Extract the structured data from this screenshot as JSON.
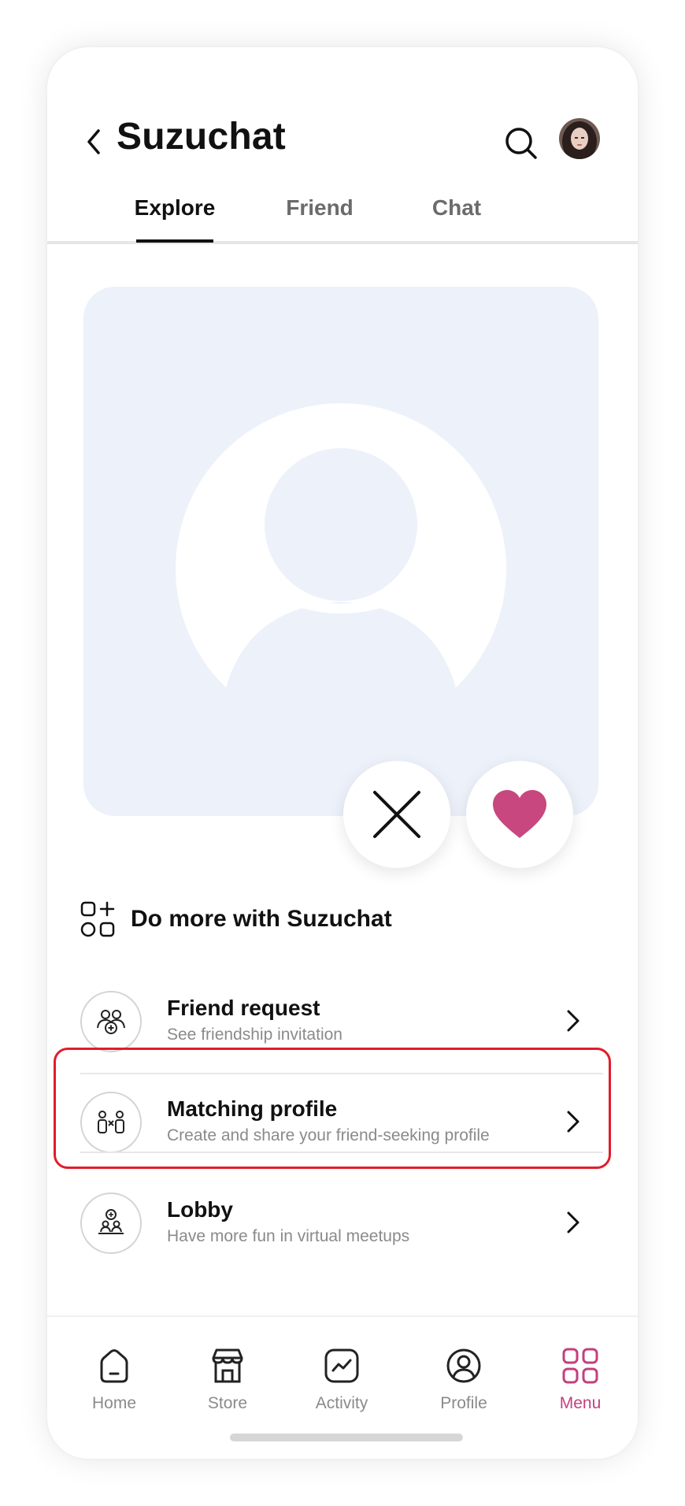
{
  "header": {
    "title": "Suzuchat"
  },
  "tabs": [
    {
      "label": "Explore",
      "active": true
    },
    {
      "label": "Friend",
      "active": false
    },
    {
      "label": "Chat",
      "active": false
    }
  ],
  "actions": {
    "dislike_icon": "close-x-icon",
    "like_icon": "heart-icon",
    "like_color": "#c8477f"
  },
  "do_more": {
    "label": "Do more with Suzuchat",
    "icon": "apps-plus-icon"
  },
  "list": [
    {
      "title": "Friend request",
      "subtitle": "See friendship invitation",
      "icon": "friend-request-icon"
    },
    {
      "title": "Matching profile",
      "subtitle": "Create and share your friend-seeking profile",
      "icon": "matching-profile-icon",
      "highlighted": true
    },
    {
      "title": "Lobby",
      "subtitle": "Have more fun in virtual meetups",
      "icon": "lobby-icon"
    }
  ],
  "nav": [
    {
      "label": "Home",
      "icon": "home-icon"
    },
    {
      "label": "Store",
      "icon": "store-icon"
    },
    {
      "label": "Activity",
      "icon": "activity-icon"
    },
    {
      "label": "Profile",
      "icon": "profile-icon"
    },
    {
      "label": "Menu",
      "icon": "menu-grid-icon",
      "active": true
    }
  ],
  "colors": {
    "accent": "#c2407e",
    "card_bg": "#edf1fa",
    "highlight": "#e11d2b"
  }
}
